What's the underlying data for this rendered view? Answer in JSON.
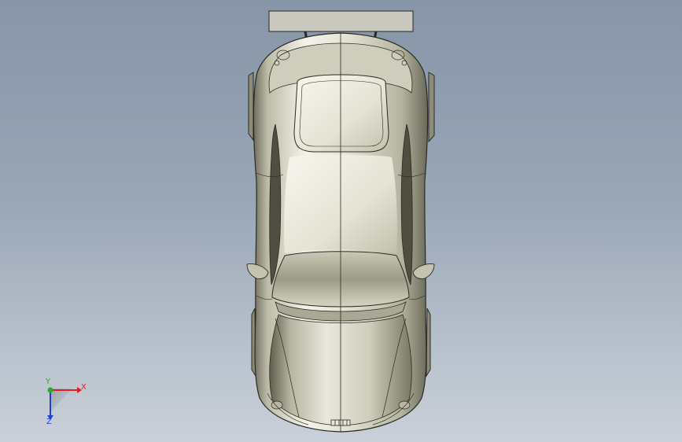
{
  "viewport": {
    "background_top": "#8795a8",
    "background_bottom": "#c9d0d9"
  },
  "model": {
    "view": "top",
    "body_color": "#d4d3c2",
    "line_color": "#2a2a22",
    "spoiler_color": "#c9c9c0"
  },
  "triad": {
    "x_label": "X",
    "y_label": "Y",
    "z_label": "Z",
    "x_color": "#e02020",
    "y_color": "#20b020",
    "z_color": "#2040d0",
    "icon": "coordinate-triad-icon"
  }
}
